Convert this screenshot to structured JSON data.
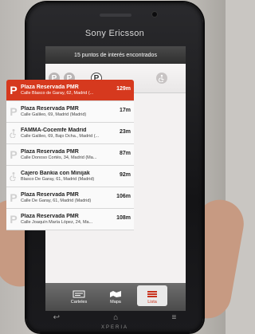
{
  "device": {
    "brand": "Sony Ericsson",
    "model": "XPERIA"
  },
  "header": {
    "status_text": "15 puntos de interés encontrados"
  },
  "filters": [
    {
      "icon": "parking-icon",
      "label": "P",
      "state": "muted"
    },
    {
      "icon": "parking-icon",
      "label": "P",
      "state": "muted"
    },
    {
      "icon": "parking-icon",
      "label": "P",
      "state": "active"
    },
    {
      "icon": "accessibility-icon",
      "label": "",
      "state": "muted"
    }
  ],
  "list": {
    "items": [
      {
        "icon": "P",
        "name": "Plaza Reservada PMR",
        "address": "Calle Blasco de Garay, 62, Madrid (...",
        "distance": "129m",
        "selected": true
      },
      {
        "icon": "P",
        "name": "Plaza Reservada PMR",
        "address": "Calle Galileo, 69, Madrid (Madrid)",
        "distance": "17m",
        "selected": false
      },
      {
        "icon": "accessibility",
        "name": "FAMMA-Cocemfe Madrid",
        "address": "Calle Galileo, 69, Bajo Dcha., Madrid (...",
        "distance": "23m",
        "selected": false
      },
      {
        "icon": "P",
        "name": "Plaza Reservada PMR",
        "address": "Calle Donoso Cortés, 34, Madrid (Ma...",
        "distance": "87m",
        "selected": false
      },
      {
        "icon": "accessibility",
        "name": "Cajero Bankia con Minijak",
        "address": "Blasco De Garay, 61, Madrid (Madrid)",
        "distance": "92m",
        "selected": false
      },
      {
        "icon": "P",
        "name": "Plaza Reservada PMR",
        "address": "Calle De Garay, 61, Madrid (Madrid)",
        "distance": "106m",
        "selected": false
      },
      {
        "icon": "P",
        "name": "Plaza Reservada PMR",
        "address": "Calle Joaquín María López, 24, Ma...",
        "distance": "108m",
        "selected": false
      }
    ]
  },
  "tabs": [
    {
      "label": "Carteles",
      "icon": "signs-icon",
      "active": false
    },
    {
      "label": "Mapa",
      "icon": "map-icon",
      "active": false
    },
    {
      "label": "Lista",
      "icon": "list-icon",
      "active": true
    }
  ],
  "colors": {
    "accent": "#d6391e"
  }
}
